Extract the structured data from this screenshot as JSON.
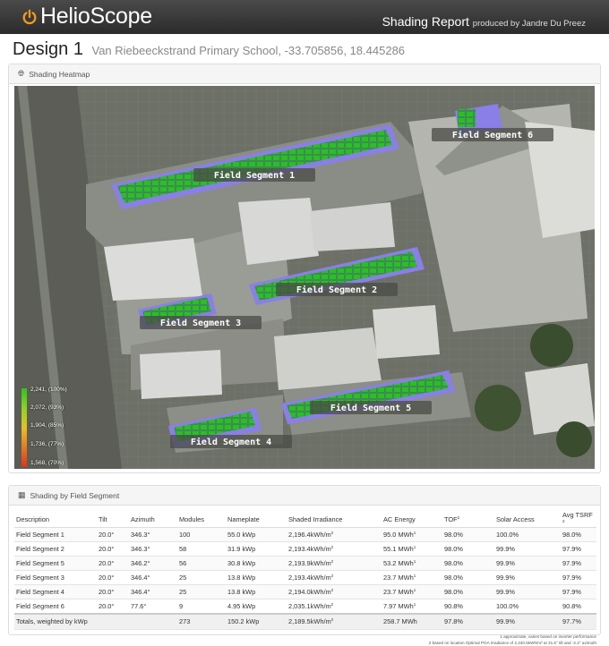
{
  "header": {
    "brand": "HelioScope",
    "report_title": "Shading Report",
    "produced_by": "produced by Jandre Du Preez"
  },
  "design": {
    "name": "Design 1",
    "location": "Van Riebeeckstrand Primary School, -33.705856, 18.445286"
  },
  "heatmap_panel": {
    "title": "Shading Heatmap",
    "icon": "globe-icon",
    "segments": [
      "Field Segment 1",
      "Field Segment 2",
      "Field Segment 3",
      "Field Segment 4",
      "Field Segment 5",
      "Field Segment 6"
    ],
    "legend": [
      "2,241, (100%)",
      "2,072, (93%)",
      "1,904, (85%)",
      "1,736, (77%)",
      "1,568, (70%)"
    ],
    "colors": {
      "module_green": "#2bbf24",
      "roof_purple": "#8a7fe6",
      "legend_top": "#2ec41a",
      "legend_bottom": "#e0321e"
    }
  },
  "table_panel": {
    "title": "Shading by Field Segment",
    "icon": "table-icon",
    "columns": [
      "Description",
      "Tilt",
      "Azimuth",
      "Modules",
      "Nameplate",
      "Shaded Irradiance",
      "AC Energy",
      "TOF",
      "Solar Access",
      "Avg TSRF"
    ],
    "rows": [
      [
        "Field Segment 1",
        "20.0°",
        "346.3°",
        "100",
        "55.0 kWp",
        "2,196.4kWh/m",
        "95.0 MWh",
        "98.0%",
        "100.0%",
        "98.0%"
      ],
      [
        "Field Segment 2",
        "20.0°",
        "346.3°",
        "58",
        "31.9 kWp",
        "2,193.4kWh/m",
        "55.1 MWh",
        "98.0%",
        "99.9%",
        "97.9%"
      ],
      [
        "Field Segment 5",
        "20.0°",
        "346.2°",
        "56",
        "30.8 kWp",
        "2,193.9kWh/m",
        "53.2 MWh",
        "98.0%",
        "99.9%",
        "97.9%"
      ],
      [
        "Field Segment 3",
        "20.0°",
        "346.4°",
        "25",
        "13.8 kWp",
        "2,193.4kWh/m",
        "23.7 MWh",
        "98.0%",
        "99.9%",
        "97.9%"
      ],
      [
        "Field Segment 4",
        "20.0°",
        "346.4°",
        "25",
        "13.8 kWp",
        "2,194.0kWh/m",
        "23.7 MWh",
        "98.0%",
        "99.9%",
        "97.9%"
      ],
      [
        "Field Segment 6",
        "20.0°",
        "77.6°",
        "9",
        "4.95 kWp",
        "2,035.1kWh/m",
        "7.97 MWh",
        "90.8%",
        "100.0%",
        "90.8%"
      ]
    ],
    "totals": [
      "Totals, weighted by kWp",
      "",
      "",
      "273",
      "150.2 kWp",
      "2,189.5kWh/m",
      "258.7 MWh",
      "97.8%",
      "99.9%",
      "97.7%"
    ],
    "footnote_1": "approximate, varies based on inverter performance",
    "footnote_2": "based on location Optimal POA Irradiance of 2,240.5kWh/m² at 31.5° tilt and -2.2° azimuth"
  }
}
